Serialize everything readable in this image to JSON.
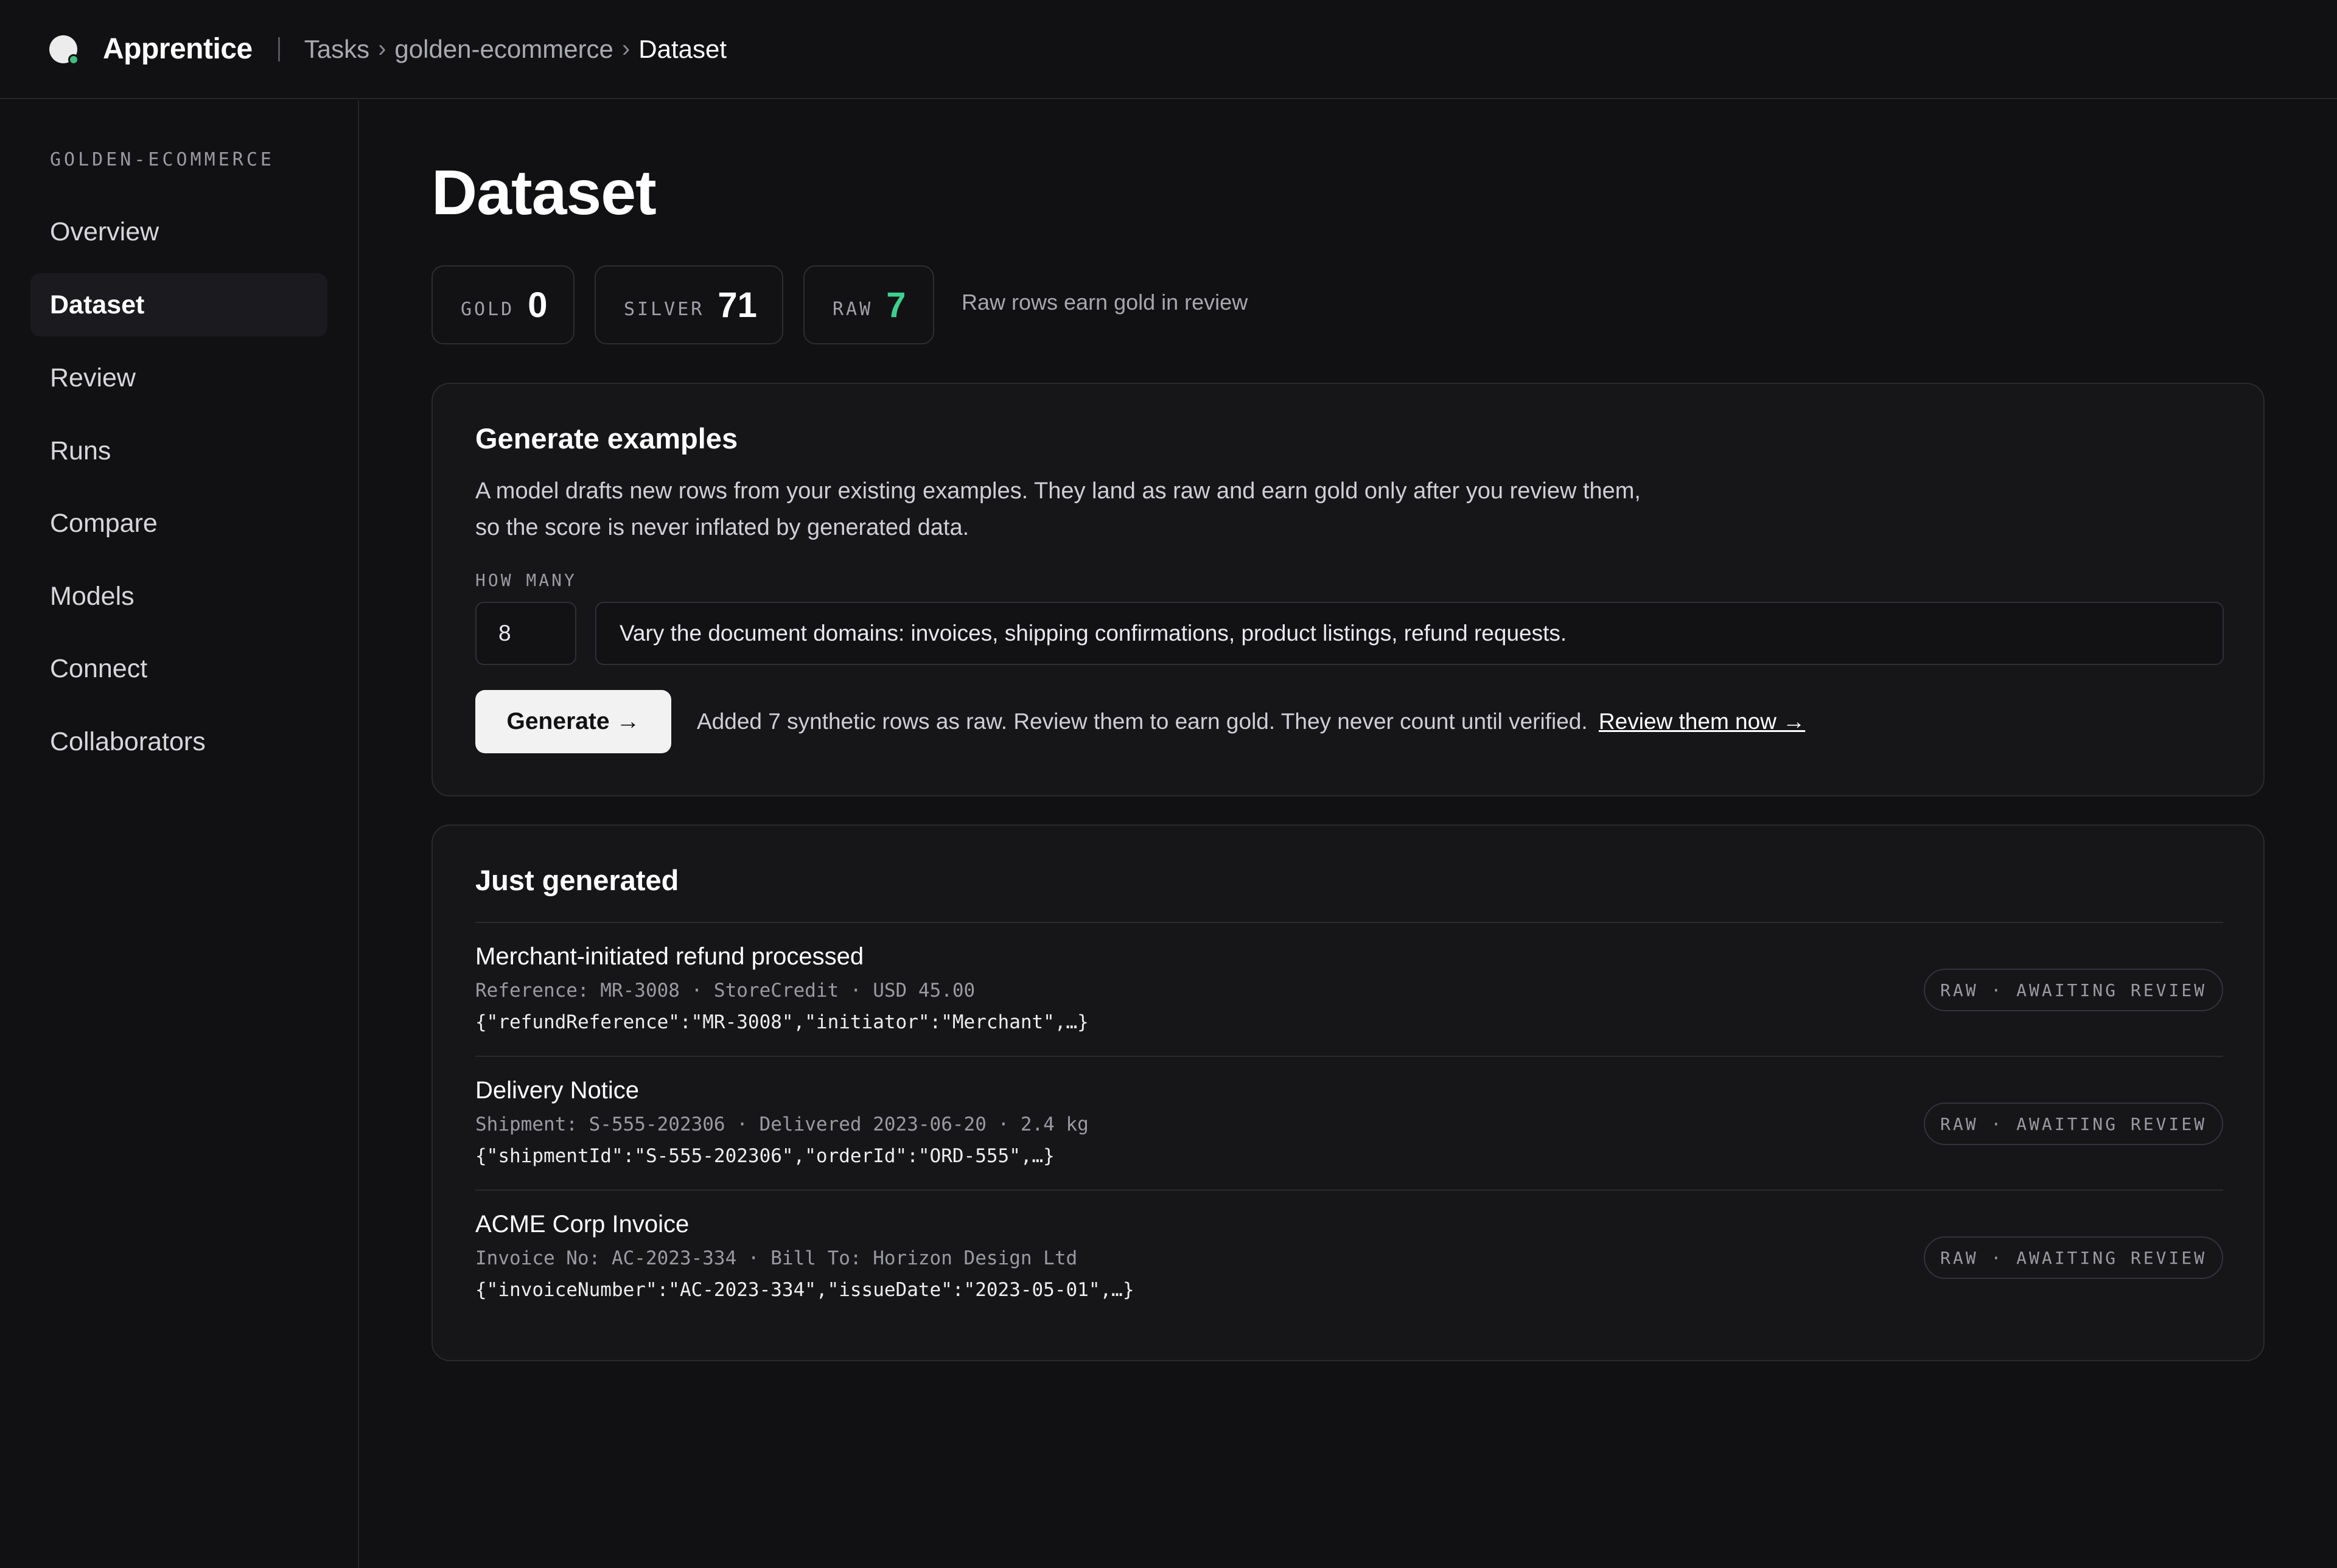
{
  "app": {
    "name": "Apprentice"
  },
  "breadcrumb": {
    "items": [
      "Tasks",
      "golden-ecommerce"
    ],
    "current": "Dataset",
    "separator": "›"
  },
  "sidebar": {
    "heading": "GOLDEN-ECOMMERCE",
    "items": [
      {
        "label": "Overview",
        "active": false
      },
      {
        "label": "Dataset",
        "active": true
      },
      {
        "label": "Review",
        "active": false
      },
      {
        "label": "Runs",
        "active": false
      },
      {
        "label": "Compare",
        "active": false
      },
      {
        "label": "Models",
        "active": false
      },
      {
        "label": "Connect",
        "active": false
      },
      {
        "label": "Collaborators",
        "active": false
      }
    ]
  },
  "page": {
    "title": "Dataset"
  },
  "stats": {
    "gold": {
      "label": "GOLD",
      "value": "0"
    },
    "silver": {
      "label": "SILVER",
      "value": "71"
    },
    "raw": {
      "label": "RAW",
      "value": "7"
    },
    "note": "Raw rows earn gold in review"
  },
  "generate": {
    "title": "Generate examples",
    "description_line1": "A model drafts new rows from your existing examples. They land as raw and earn gold only after you review them,",
    "description_line2": "so the score is never inflated by generated data.",
    "how_many_label": "HOW MANY",
    "how_many_value": "8",
    "instructions_value": "Vary the document domains: invoices, shipping confirmations, product listings, refund requests.",
    "button_label": "Generate →",
    "result_message": "Added 7 synthetic rows as raw. Review them to earn gold. They never count until verified.",
    "review_link": "Review them now →"
  },
  "just_generated": {
    "title": "Just generated",
    "rows": [
      {
        "title": "Merchant-initiated refund processed",
        "meta": "Reference: MR-3008 · StoreCredit · USD 45.00",
        "json": "{\"refundReference\":\"MR-3008\",\"initiator\":\"Merchant\",…}",
        "badge": "RAW · AWAITING REVIEW"
      },
      {
        "title": "Delivery Notice",
        "meta": "Shipment: S-555-202306 · Delivered 2023-06-20 · 2.4 kg",
        "json": "{\"shipmentId\":\"S-555-202306\",\"orderId\":\"ORD-555\",…}",
        "badge": "RAW · AWAITING REVIEW"
      },
      {
        "title": "ACME Corp Invoice",
        "meta": "Invoice No: AC-2023-334 · Bill To: Horizon Design Ltd",
        "json": "{\"invoiceNumber\":\"AC-2023-334\",\"issueDate\":\"2023-05-01\",…}",
        "badge": "RAW · AWAITING REVIEW"
      }
    ]
  },
  "colors": {
    "accent_green": "#3ecf8e",
    "background": "#111113",
    "card": "#161619"
  }
}
